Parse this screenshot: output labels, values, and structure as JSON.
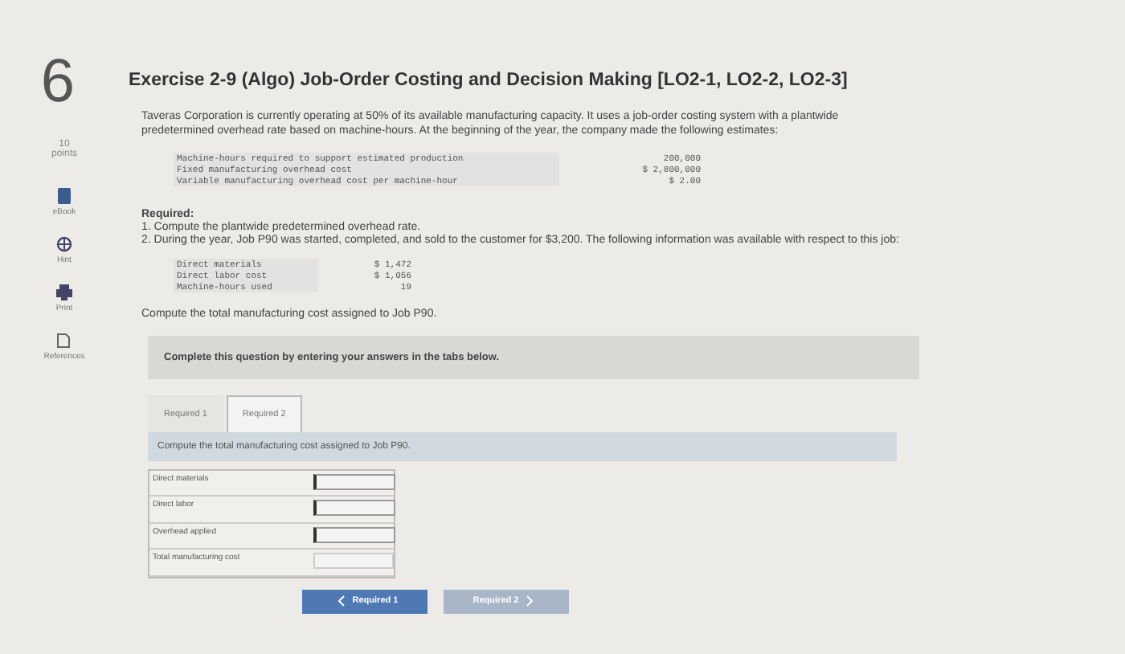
{
  "question": {
    "number": "6",
    "points": "10",
    "points_label": "points"
  },
  "tools": [
    {
      "kind": "book",
      "label": "eBook"
    },
    {
      "kind": "hint",
      "label": "Hint"
    },
    {
      "kind": "print",
      "label": "Print"
    },
    {
      "kind": "references",
      "label": "References"
    }
  ],
  "title": "Exercise 2-9 (Algo) Job-Order Costing and Decision Making [LO2-1, LO2-2, LO2-3]",
  "intro": "Taveras Corporation is currently operating at 50% of its available manufacturing capacity. It uses a job-order costing system with a plantwide predetermined overhead rate based on machine-hours. At the beginning of the year, the company made the following estimates:",
  "estimates": [
    {
      "label": "Machine-hours required to support estimated production",
      "value": "200,000"
    },
    {
      "label": "Fixed manufacturing overhead cost",
      "value": "$ 2,800,000"
    },
    {
      "label": "Variable manufacturing overhead cost per machine-hour",
      "value": "$ 2.00"
    }
  ],
  "required_heading": "Required:",
  "required_items": [
    "1. Compute the plantwide predetermined overhead rate.",
    "2. During the year, Job P90 was started, completed, and sold to the customer for $3,200. The following information was available with respect to this job:"
  ],
  "job": [
    {
      "label": "Direct materials",
      "value": "$ 1,472"
    },
    {
      "label": "Direct labor cost",
      "value": "$ 1,056"
    },
    {
      "label": "Machine-hours used",
      "value": "19"
    }
  ],
  "question_text": "Compute the total manufacturing cost assigned to Job P90.",
  "instructions": "Complete this question by entering your answers in the tabs below.",
  "tabs": [
    {
      "label": "Required 1",
      "selected": false
    },
    {
      "label": "Required 2",
      "selected": true
    }
  ],
  "tab_prompt": "Compute the total manufacturing cost assigned to Job P90.",
  "answer_rows": [
    {
      "label": "Direct materials",
      "editable": true
    },
    {
      "label": "Direct labor",
      "editable": true
    },
    {
      "label": "Overhead applied",
      "editable": true
    },
    {
      "label": "Total manufacturing cost",
      "editable": false
    }
  ],
  "nav": [
    {
      "label": "Required 1",
      "kind": "prev",
      "disabled": false
    },
    {
      "label": "Required 2",
      "kind": "next",
      "disabled": true
    }
  ]
}
